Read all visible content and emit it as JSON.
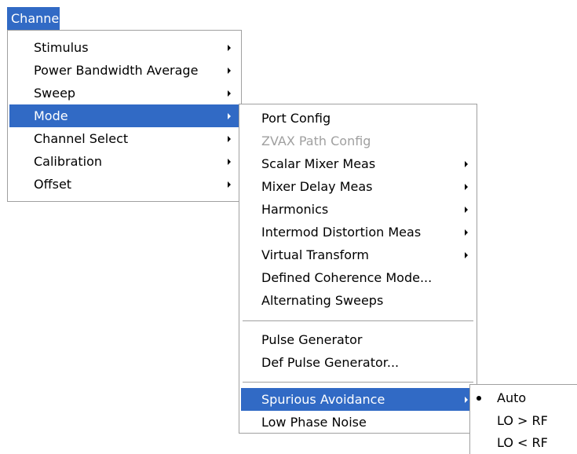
{
  "menubar": {
    "title": "Channel"
  },
  "channel_menu": {
    "items": [
      {
        "label": "Stimulus",
        "submenu": true
      },
      {
        "label": "Power Bandwidth Average",
        "submenu": true
      },
      {
        "label": "Sweep",
        "submenu": true
      },
      {
        "label": "Mode",
        "submenu": true,
        "selected": true
      },
      {
        "label": "Channel Select",
        "submenu": true
      },
      {
        "label": "Calibration",
        "submenu": true
      },
      {
        "label": "Offset",
        "submenu": true
      }
    ]
  },
  "mode_menu": {
    "items": [
      {
        "label": "Port Config"
      },
      {
        "label": "ZVAX Path Config",
        "disabled": true
      },
      {
        "label": "Scalar Mixer Meas",
        "submenu": true
      },
      {
        "label": "Mixer Delay Meas",
        "submenu": true
      },
      {
        "label": "Harmonics",
        "submenu": true
      },
      {
        "label": "Intermod Distortion Meas",
        "submenu": true
      },
      {
        "label": "Virtual Transform",
        "submenu": true
      },
      {
        "label": "Defined Coherence Mode..."
      },
      {
        "label": "Alternating Sweeps"
      },
      {
        "label": "Pulse Generator"
      },
      {
        "label": "Def Pulse Generator..."
      },
      {
        "label": "Spurious Avoidance",
        "submenu": true,
        "selected": true
      },
      {
        "label": "Low Phase Noise"
      }
    ]
  },
  "spurious_menu": {
    "items": [
      {
        "label": "Auto",
        "checked": true
      },
      {
        "label": "LO > RF"
      },
      {
        "label": "LO < RF"
      }
    ]
  },
  "colors": {
    "highlight": "#316ac5",
    "highlight_text": "#ffffff",
    "disabled_text": "#a0a0a0",
    "border": "#a0a0a0"
  }
}
